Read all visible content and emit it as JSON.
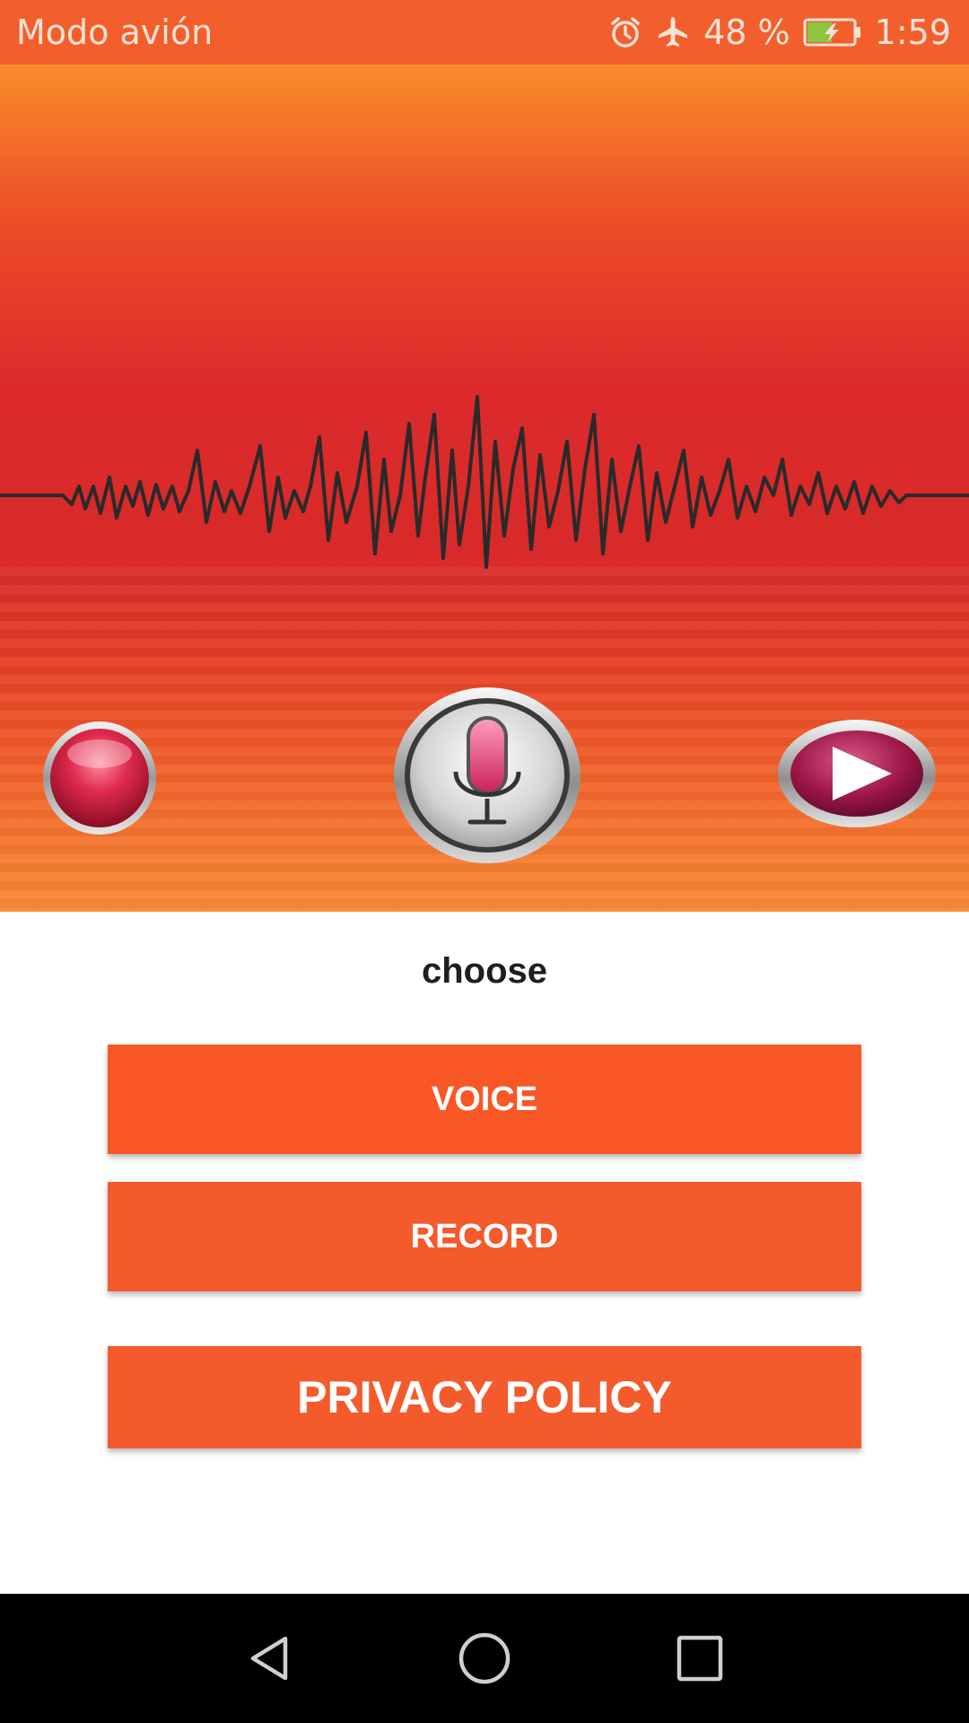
{
  "status_bar": {
    "left_text": "Modo avión",
    "battery_percent": "48 %",
    "time": "1:59",
    "icons": [
      "alarm-icon",
      "airplane-icon",
      "battery-charging-icon"
    ],
    "color": "#f25f2c"
  },
  "hero": {
    "icons": [
      "record-button-icon",
      "microphone-icon",
      "play-button-icon"
    ]
  },
  "main": {
    "heading": "choose",
    "buttons": {
      "voice": "VOICE",
      "record": "RECORD",
      "privacy": "PRIVACY POLICY"
    },
    "accent_color": "#f4592c"
  },
  "nav_bar": {
    "icons": [
      "back-icon",
      "home-icon",
      "recents-icon"
    ]
  }
}
